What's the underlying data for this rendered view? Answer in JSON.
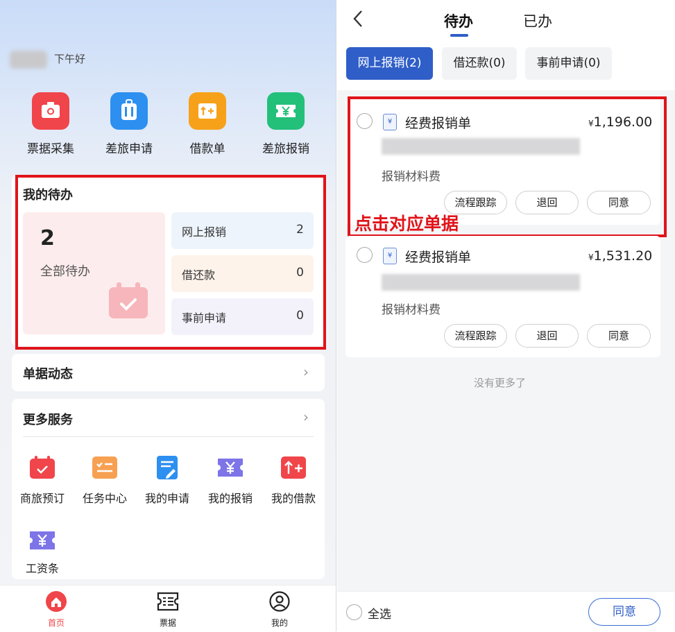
{
  "left": {
    "greeting": "下午好",
    "quick_actions": [
      {
        "label": "票据采集",
        "icon": "camera-icon",
        "color": "#f0454a"
      },
      {
        "label": "差旅申请",
        "icon": "luggage-icon",
        "color": "#2d8ff0"
      },
      {
        "label": "借款单",
        "icon": "loan-icon",
        "color": "#f7a11a"
      },
      {
        "label": "差旅报销",
        "icon": "ticket-yen-icon",
        "color": "#23c07a"
      }
    ],
    "todo": {
      "title": "我的待办",
      "total": "2",
      "total_label": "全部待办",
      "items": [
        {
          "label": "网上报销",
          "count": "2"
        },
        {
          "label": "借还款",
          "count": "0"
        },
        {
          "label": "事前申请",
          "count": "0"
        }
      ]
    },
    "doc_dynamics": "单据动态",
    "more_services": {
      "title": "更多服务",
      "items": [
        {
          "label": "商旅预订",
          "icon": "calendar-check-icon"
        },
        {
          "label": "任务中心",
          "icon": "task-list-icon"
        },
        {
          "label": "我的申请",
          "icon": "edit-doc-icon"
        },
        {
          "label": "我的报销",
          "icon": "yen-ticket-icon"
        },
        {
          "label": "我的借款",
          "icon": "loan-icon"
        },
        {
          "label": "工资条",
          "icon": "salary-icon"
        }
      ]
    },
    "tabbar": [
      {
        "label": "首页",
        "icon": "home-icon",
        "active": true
      },
      {
        "label": "票据",
        "icon": "receipt-icon"
      },
      {
        "label": "我的",
        "icon": "user-icon"
      }
    ]
  },
  "right": {
    "back": "<",
    "tabs": {
      "pending": "待办",
      "done": "已办"
    },
    "chips": [
      "网上报销(2)",
      "借还款(0)",
      "事前申请(0)"
    ],
    "docs": [
      {
        "title": "经费报销单",
        "currency": "¥",
        "amount": "1,196.00",
        "category": "报销材料费"
      },
      {
        "title": "经费报销单",
        "currency": "¥",
        "amount": "1,531.20",
        "category": "报销材料费"
      }
    ],
    "buttons": {
      "track": "流程跟踪",
      "reject": "退回",
      "agree": "同意"
    },
    "annotation": "点击对应单据",
    "no_more": "没有更多了",
    "select_all": "全选",
    "agree_all": "同意"
  },
  "colors": {
    "accent": "#2f5ec8",
    "annotation": "#e0141a"
  }
}
